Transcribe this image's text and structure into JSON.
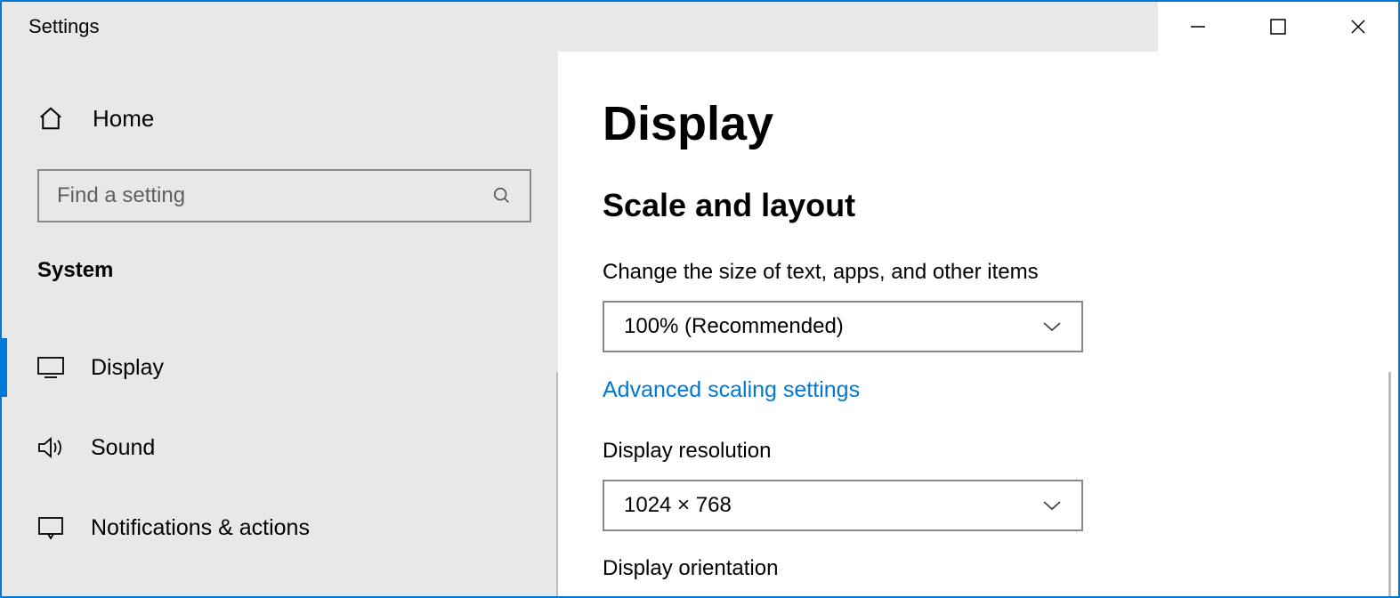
{
  "window": {
    "title": "Settings"
  },
  "sidebar": {
    "home_label": "Home",
    "search_placeholder": "Find a setting",
    "category": "System",
    "items": [
      {
        "label": "Display"
      },
      {
        "label": "Sound"
      },
      {
        "label": "Notifications & actions"
      }
    ]
  },
  "main": {
    "title": "Display",
    "section_title": "Scale and layout",
    "scale": {
      "label": "Change the size of text, apps, and other items",
      "value": "100% (Recommended)"
    },
    "advanced_link": "Advanced scaling settings",
    "resolution": {
      "label": "Display resolution",
      "value": "1024 × 768"
    },
    "orientation": {
      "label": "Display orientation"
    }
  }
}
